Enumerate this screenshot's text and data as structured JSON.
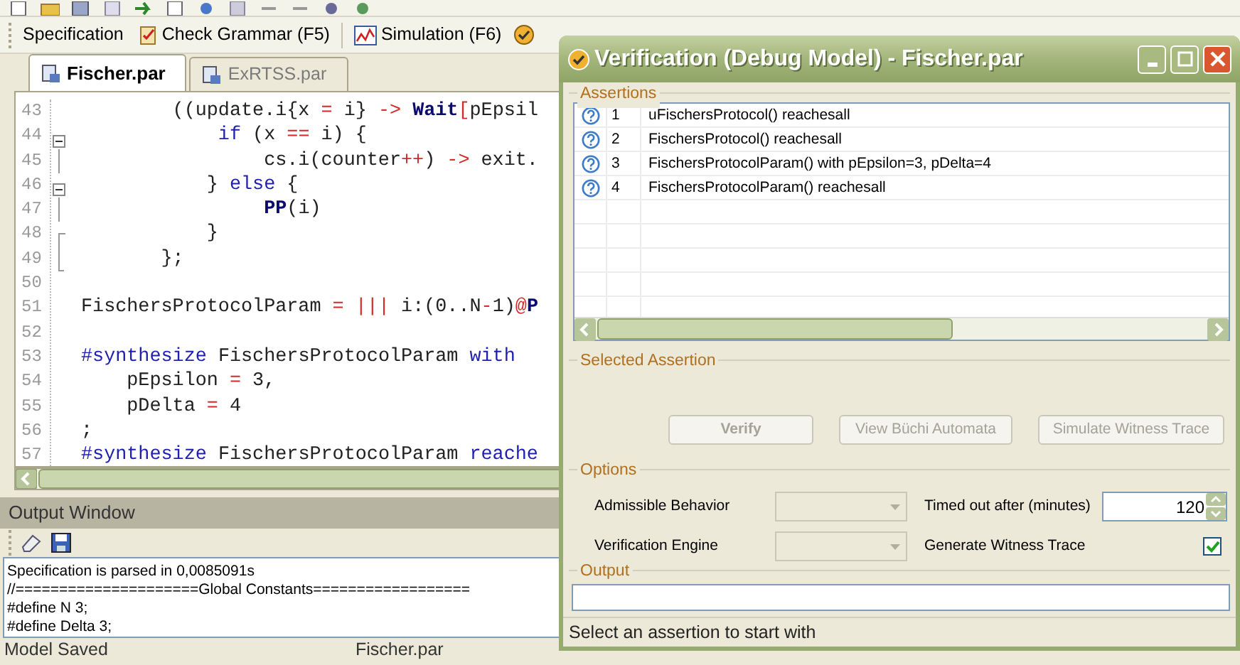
{
  "toolbar": [
    {
      "kind": "text",
      "label": "Specification"
    },
    {
      "kind": "grammar",
      "label": "Check Grammar (F5)"
    },
    {
      "kind": "simulation",
      "label": "Simulation (F6)"
    },
    {
      "kind": "verification"
    }
  ],
  "tabs": [
    {
      "label": "Fischer.par",
      "selected": true
    },
    {
      "label": "ExRTSS.par",
      "selected": false
    }
  ],
  "editor": {
    "lines": [
      {
        "number": "43",
        "kind": "plain",
        "tokens": [
          {
            "t": "        ((update.i{x ",
            "color": "#222222"
          },
          {
            "t": "=",
            "color": "#d42a2a"
          },
          {
            "t": " i} ",
            "color": "#222222"
          },
          {
            "t": "->",
            "color": "#d42a2a"
          },
          {
            "t": " Wait",
            "color": "#0b0b6e",
            "bold": true
          },
          {
            "t": "[",
            "color": "#d42a2a"
          },
          {
            "t": "pEpsil",
            "color": "#222222"
          }
        ]
      },
      {
        "number": "44",
        "kind": "collapse",
        "tokens": [
          {
            "t": "            if",
            "color": "#1f1fb0"
          },
          {
            "t": " (x ",
            "color": "#222222"
          },
          {
            "t": "==",
            "color": "#d42a2a"
          },
          {
            "t": " i) {",
            "color": "#222222"
          }
        ]
      },
      {
        "number": "45",
        "kind": "inner",
        "tokens": [
          {
            "t": "                cs.i(counter",
            "color": "#222222"
          },
          {
            "t": "++",
            "color": "#d42a2a"
          },
          {
            "t": ") ",
            "color": "#222222"
          },
          {
            "t": "->",
            "color": "#d42a2a"
          },
          {
            "t": " exit.",
            "color": "#222222"
          }
        ]
      },
      {
        "number": "46",
        "kind": "collapse",
        "tokens": [
          {
            "t": "           } ",
            "color": "#222222"
          },
          {
            "t": "else",
            "color": "#1f1fb0"
          },
          {
            "t": " {",
            "color": "#222222"
          }
        ]
      },
      {
        "number": "47",
        "kind": "inner",
        "tokens": [
          {
            "t": "                PP",
            "color": "#0b0b6e",
            "bold": true
          },
          {
            "t": "(i)",
            "color": "#222222"
          }
        ]
      },
      {
        "number": "48",
        "kind": "branch",
        "tokens": [
          {
            "t": "           }",
            "color": "#222222"
          }
        ]
      },
      {
        "number": "49",
        "kind": "end",
        "tokens": [
          {
            "t": "       };",
            "color": "#222222"
          }
        ]
      },
      {
        "number": "50",
        "kind": "plain"
      },
      {
        "number": "51",
        "kind": "plain",
        "tokens": [
          {
            "t": "FischersProtocolParam ",
            "color": "#222222"
          },
          {
            "t": "=",
            "color": "#d42a2a"
          },
          {
            "t": " |||",
            "color": "#d42a2a"
          },
          {
            "t": " i:(0..N",
            "color": "#222222"
          },
          {
            "t": "-",
            "color": "#d42a2a"
          },
          {
            "t": "1)",
            "color": "#222222"
          },
          {
            "t": "@",
            "color": "#d42a2a"
          },
          {
            "t": "P",
            "color": "#0b0b6e",
            "bold": true
          }
        ]
      },
      {
        "number": "52",
        "kind": "plain"
      },
      {
        "number": "53",
        "kind": "plain",
        "tokens": [
          {
            "t": "#synthesize",
            "color": "#1f1fb0"
          },
          {
            "t": " FischersProtocolParam ",
            "color": "#222222"
          },
          {
            "t": "with",
            "color": "#1f1fb0"
          }
        ]
      },
      {
        "number": "54",
        "kind": "plain",
        "tokens": [
          {
            "t": "    pEpsilon ",
            "color": "#222222"
          },
          {
            "t": "=",
            "color": "#d42a2a"
          },
          {
            "t": " 3,",
            "color": "#222222"
          }
        ]
      },
      {
        "number": "55",
        "kind": "plain",
        "tokens": [
          {
            "t": "    pDelta ",
            "color": "#222222"
          },
          {
            "t": "=",
            "color": "#d42a2a"
          },
          {
            "t": " 4",
            "color": "#222222"
          }
        ]
      },
      {
        "number": "56",
        "kind": "plain",
        "tokens": [
          {
            "t": ";",
            "color": "#222222"
          }
        ]
      },
      {
        "number": "57",
        "kind": "plain",
        "tokens": [
          {
            "t": "#synthesize",
            "color": "#1f1fb0"
          },
          {
            "t": " FischersProtocolParam ",
            "color": "#222222"
          },
          {
            "t": "reache",
            "color": "#1f1fb0"
          }
        ]
      }
    ]
  },
  "output_window": {
    "title": "Output Window",
    "lines": [
      "Specification is parsed in 0,0085091s",
      "//=====================Global Constants==================",
      "#define N 3;",
      "#define Delta 3;"
    ]
  },
  "status_bar": [
    "Model Saved",
    "Fischer.par"
  ],
  "dialog": {
    "title": "Verification (Debug Model) - Fischer.par",
    "assertions": {
      "label": "Assertions",
      "rows": [
        {
          "kind": "unknown",
          "number": "1",
          "text": "uFischersProtocol() reachesall"
        },
        {
          "kind": "unknown",
          "number": "2",
          "text": "FischersProtocol() reachesall"
        },
        {
          "kind": "unknown",
          "number": "3",
          "text": "FischersProtocolParam() with pEpsilon=3, pDelta=4"
        },
        {
          "kind": "unknown",
          "number": "4",
          "text": "FischersProtocolParam() reachesall"
        }
      ]
    },
    "selected_assertion": {
      "label": "Selected Assertion",
      "buttons": [
        {
          "label": "Verify",
          "disabled": true,
          "default": true
        },
        {
          "label": "View Büchi Automata",
          "disabled": true,
          "default": false
        },
        {
          "label": "Simulate Witness Trace",
          "disabled": true,
          "default": false
        }
      ]
    },
    "options": {
      "label": "Options",
      "items": [
        {
          "kind": "combo",
          "label": "Admissible Behavior",
          "disabled": true
        },
        {
          "kind": "spin",
          "label": "Timed out after (minutes)",
          "value": "120"
        },
        {
          "kind": "combo",
          "label": "Verification Engine",
          "disabled": true
        },
        {
          "kind": "checkbox",
          "label": "Generate Witness Trace",
          "checked": true
        }
      ]
    },
    "output": {
      "label": "Output"
    },
    "status": "Select an assertion to start with"
  }
}
